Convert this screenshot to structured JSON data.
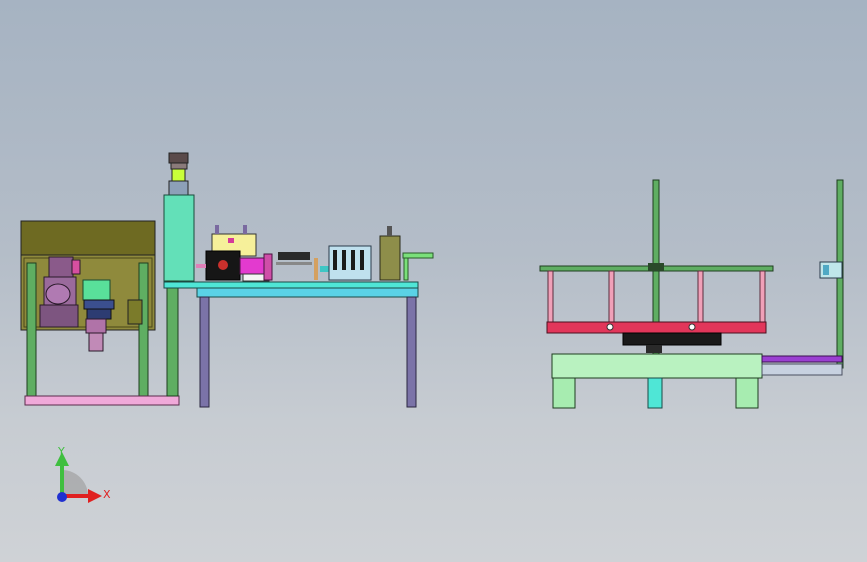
{
  "view": {
    "triad": {
      "y_label": "Y",
      "x_label": "X"
    },
    "colors": {
      "frame_green": "#5fae62",
      "cyan_plate": "#4fe6d6",
      "table_leg_purple": "#7b73a8",
      "pink_rail": "#f0a9d9",
      "olive_box": "#8f8a3c",
      "red_carriage": "#e2365a",
      "mint_block": "#b9f2c0",
      "purple_bar": "#9a3fd1"
    }
  }
}
